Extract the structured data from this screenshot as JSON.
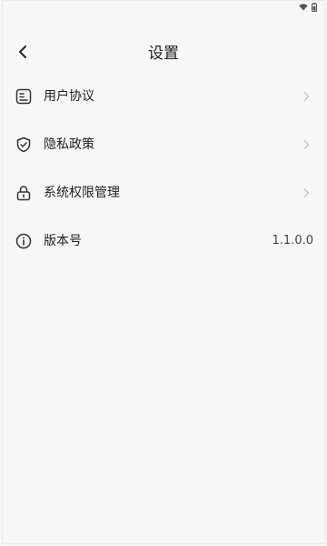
{
  "status_bar": {
    "icons": [
      "wifi-icon",
      "battery-icon"
    ]
  },
  "header": {
    "title": "设置",
    "back_icon": "chevron-left-icon"
  },
  "settings": {
    "items": [
      {
        "label": "用户协议",
        "icon": "document-icon",
        "has_chevron": true
      },
      {
        "label": "隐私政策",
        "icon": "shield-icon",
        "has_chevron": true
      },
      {
        "label": "系统权限管理",
        "icon": "lock-icon",
        "has_chevron": true
      },
      {
        "label": "版本号",
        "icon": "info-icon",
        "value": "1.1.0.0",
        "has_chevron": false
      }
    ]
  },
  "colors": {
    "background": "#f7f7f7",
    "text": "#222222",
    "chevron": "#c4c4c4"
  }
}
